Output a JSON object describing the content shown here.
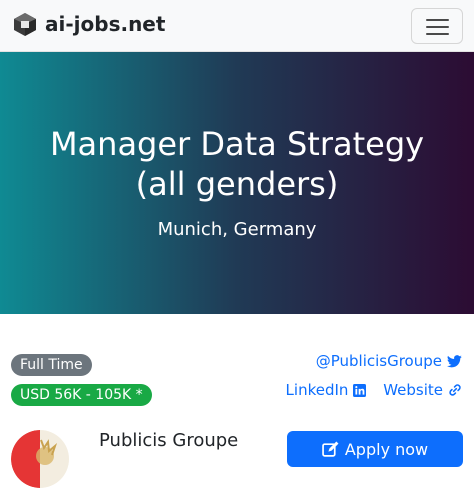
{
  "navbar": {
    "brand": "ai-jobs.net",
    "logo_icon": "ai-jobs-logo-icon",
    "menu_icon": "hamburger-menu-icon"
  },
  "hero": {
    "title": "Manager Data Strategy (all genders)",
    "location": "Munich, Germany",
    "gradient": [
      "#0f8a93",
      "#203a55",
      "#2c0c33"
    ]
  },
  "job": {
    "type_badge": "Full Time",
    "salary_badge": "USD 56K - 105K *",
    "twitter": "@PublicisGroupe",
    "linkedin": "LinkedIn",
    "website": "Website",
    "company": "Publicis Groupe",
    "apply_label": "Apply now"
  },
  "colors": {
    "link": "#0d6efd",
    "badge_type": "#6c757d",
    "badge_salary": "#19a945",
    "apply_button": "#0d6efd"
  }
}
